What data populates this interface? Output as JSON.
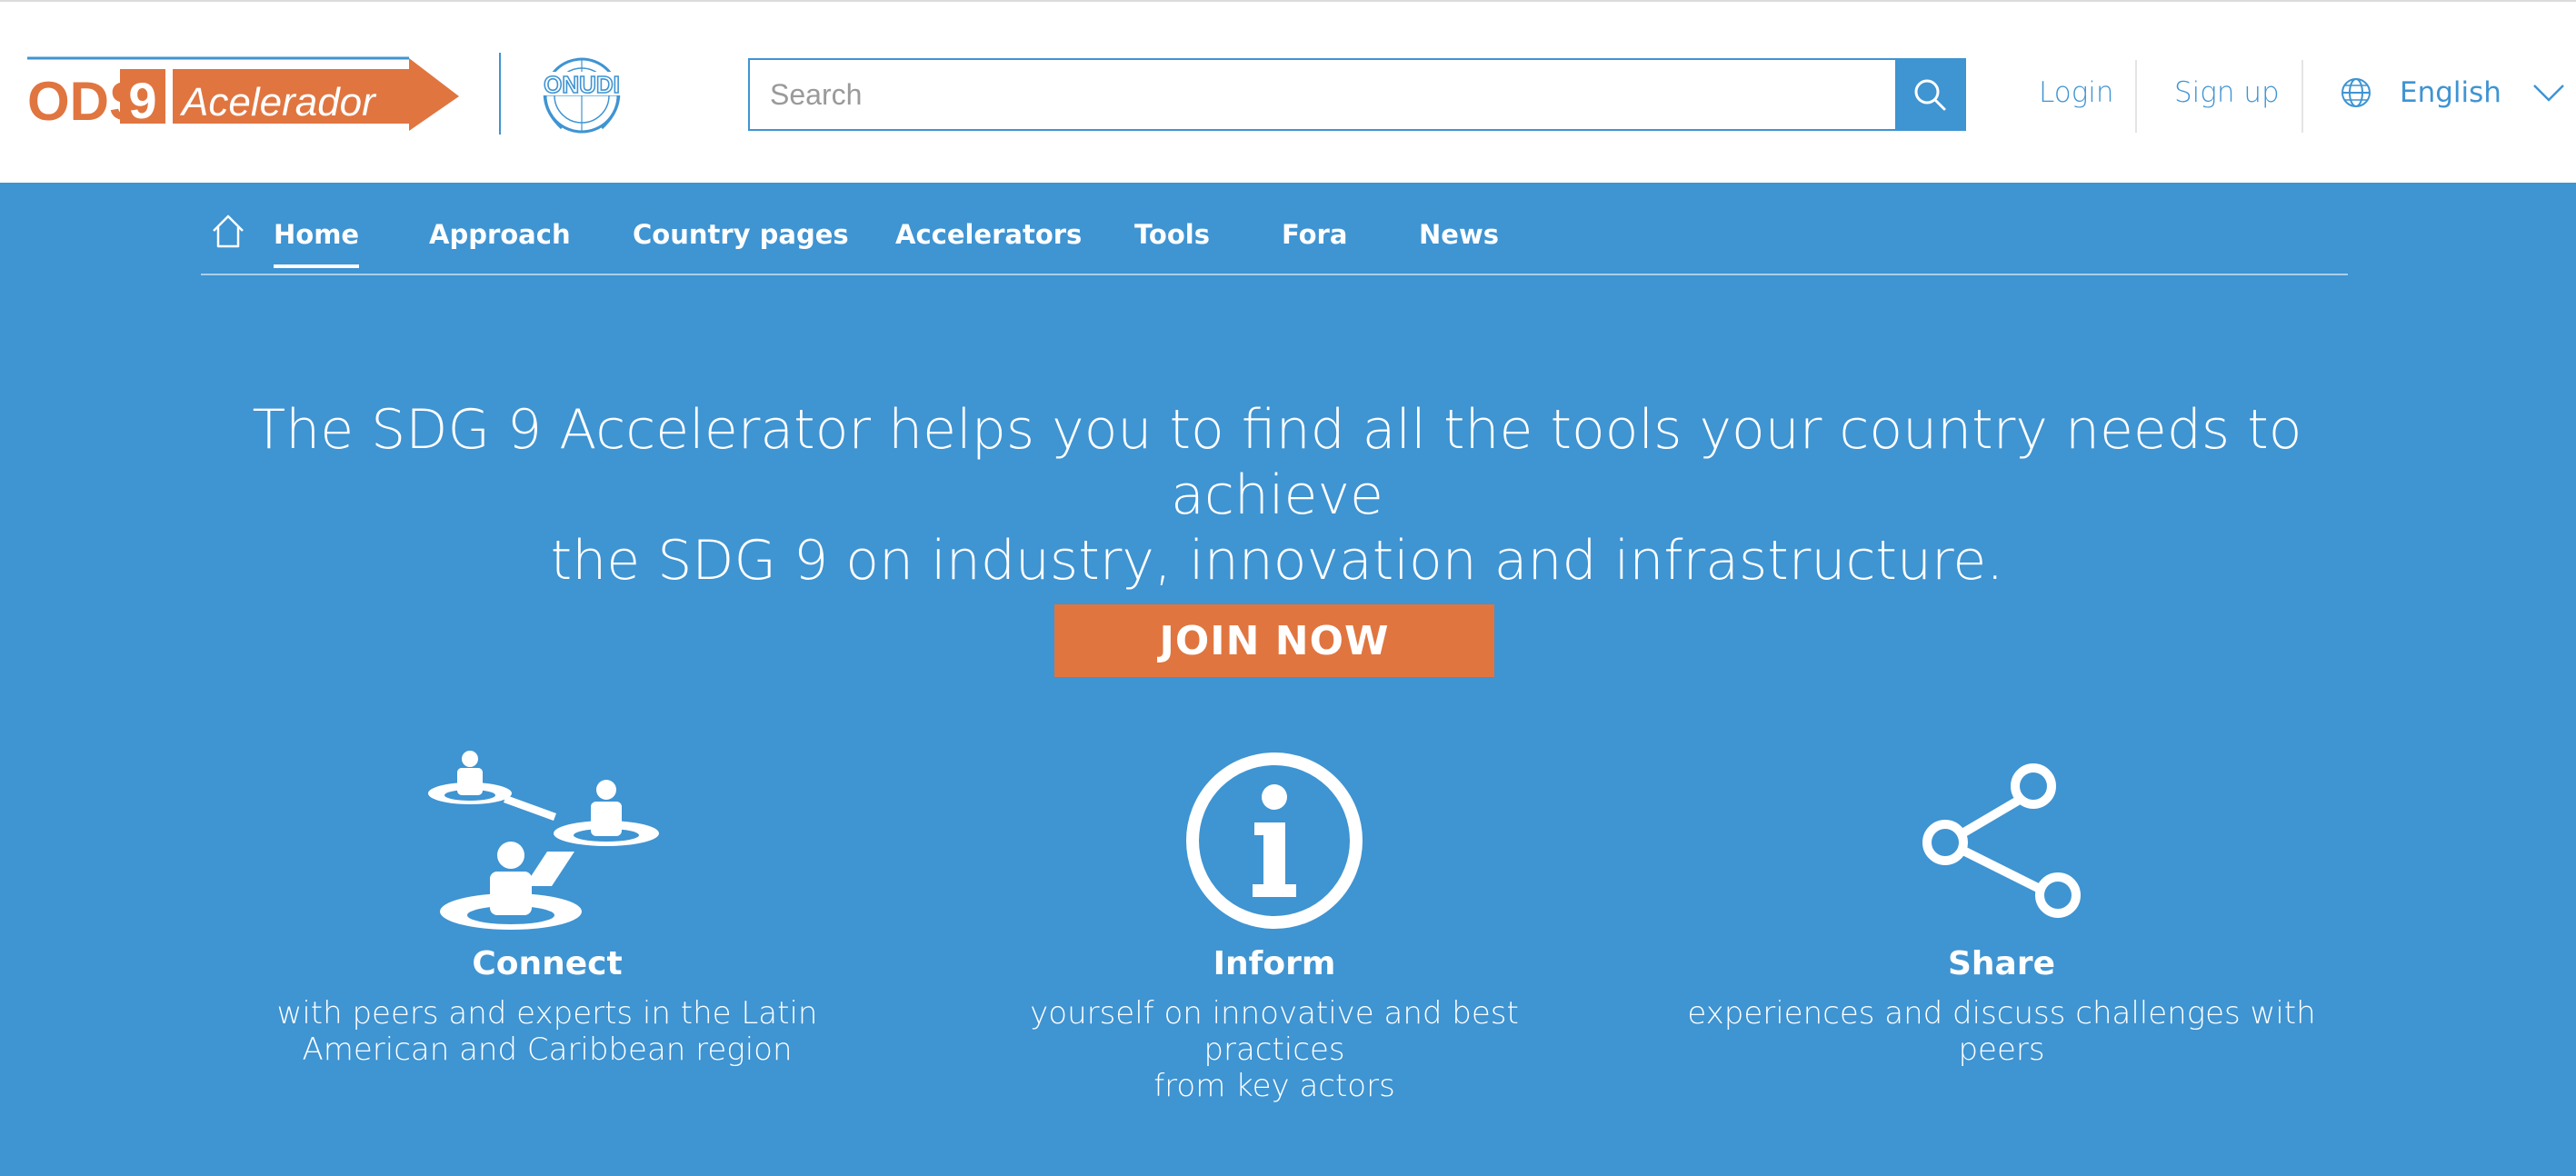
{
  "header": {
    "logo": {
      "prefix": "ODS",
      "number": "9",
      "word": "Acelerador"
    },
    "partner_logo": "ONUDI",
    "search": {
      "placeholder": "Search",
      "value": ""
    },
    "login": "Login",
    "signup": "Sign up",
    "language": "English"
  },
  "nav": {
    "items": [
      {
        "label": "Home",
        "active": true
      },
      {
        "label": "Approach"
      },
      {
        "label": "Country pages"
      },
      {
        "label": "Accelerators"
      },
      {
        "label": "Tools"
      },
      {
        "label": "Fora"
      },
      {
        "label": "News"
      }
    ]
  },
  "hero": {
    "title_line1": "The SDG 9 Accelerator helps you to find all the tools your country needs to achieve",
    "title_line2": "the SDG 9 on industry, innovation and infrastructure.",
    "cta": "JOIN NOW"
  },
  "features": [
    {
      "icon": "people-network-icon",
      "title": "Connect",
      "line1": "with peers and experts in the Latin",
      "line2": "American and Caribbean region"
    },
    {
      "icon": "info-icon",
      "title": "Inform",
      "line1": "yourself on innovative and best practices",
      "line2": "from key actors"
    },
    {
      "icon": "share-icon",
      "title": "Share",
      "line1": "experiences and discuss challenges with",
      "line2": "peers"
    }
  ],
  "colors": {
    "primary": "#3f94d2",
    "accent": "#e07540",
    "white": "#ffffff"
  }
}
